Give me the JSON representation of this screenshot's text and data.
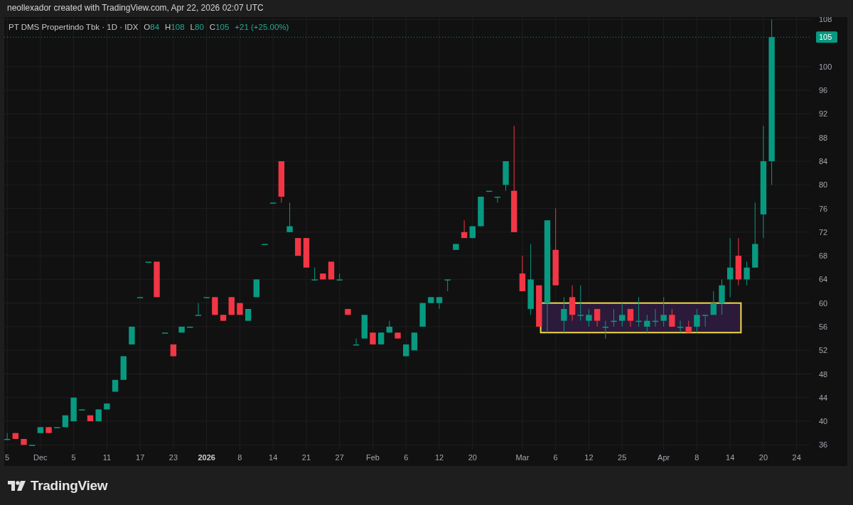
{
  "caption": "neollexador created with TradingView.com, Apr 22, 2026 02:07 UTC",
  "legend": {
    "symbol": "PT DMS Propertindo Tbk · 1D · IDX",
    "values": [
      {
        "label": "O",
        "value": "84"
      },
      {
        "label": "H",
        "value": "108"
      },
      {
        "label": "L",
        "value": "80"
      },
      {
        "label": "C",
        "value": "105"
      }
    ],
    "change": "+21 (+25.00%)"
  },
  "chart_data": {
    "type": "candlestick",
    "grid": true,
    "ylim": [
      35.2,
      108.4
    ],
    "yticks": [
      36,
      40,
      44,
      48,
      52,
      56,
      60,
      64,
      68,
      72,
      76,
      80,
      84,
      88,
      92,
      96,
      100,
      108
    ],
    "categories": [
      "5",
      null,
      null,
      null,
      "Dec",
      null,
      null,
      null,
      "5",
      null,
      null,
      null,
      "11",
      null,
      null,
      null,
      "17",
      null,
      null,
      null,
      "23",
      null,
      null,
      null,
      "2026",
      null,
      null,
      null,
      "8",
      null,
      null,
      null,
      "14",
      null,
      null,
      null,
      "21",
      null,
      null,
      null,
      "27",
      null,
      null,
      null,
      "Feb",
      null,
      null,
      null,
      "6",
      null,
      null,
      null,
      "12",
      null,
      null,
      null,
      "20",
      null,
      null,
      null,
      null,
      null,
      "Mar",
      null,
      null,
      null,
      "6",
      null,
      null,
      null,
      "12",
      null,
      null,
      null,
      "25",
      null,
      null,
      null,
      null,
      "Apr",
      null,
      null,
      null,
      "8",
      null,
      null,
      null,
      "14",
      null,
      null,
      null,
      "20",
      null,
      null,
      null,
      "24",
      null
    ],
    "ohlc": [
      [
        37,
        38,
        37,
        37
      ],
      [
        38,
        38,
        37,
        37
      ],
      [
        37,
        37,
        36,
        36
      ],
      [
        36,
        36,
        36,
        36
      ],
      [
        38,
        39,
        38,
        39
      ],
      [
        39,
        39,
        38,
        38
      ],
      [
        39,
        39,
        39,
        39
      ],
      [
        39,
        41,
        39,
        41
      ],
      [
        40,
        44,
        40,
        44
      ],
      [
        42,
        42,
        42,
        42
      ],
      [
        41,
        41,
        40,
        40
      ],
      [
        40,
        42,
        40,
        42
      ],
      [
        42,
        43,
        42,
        43
      ],
      [
        45,
        47,
        45,
        47
      ],
      [
        47,
        51,
        47,
        51
      ],
      [
        53,
        56,
        53,
        56
      ],
      [
        61,
        61,
        61,
        61
      ],
      [
        67,
        67,
        67,
        67
      ],
      [
        67,
        67,
        61,
        61
      ],
      [
        55,
        55,
        55,
        55
      ],
      [
        53,
        53,
        51,
        51
      ],
      [
        55,
        56,
        55,
        56
      ],
      [
        56,
        56,
        56,
        56
      ],
      [
        58,
        60,
        58,
        58
      ],
      [
        61,
        61,
        61,
        61
      ],
      [
        61,
        61,
        58,
        58
      ],
      [
        58,
        58,
        57,
        57
      ],
      [
        61,
        61,
        58,
        58
      ],
      [
        60,
        60,
        58,
        58
      ],
      [
        57,
        59,
        57,
        59
      ],
      [
        61,
        64,
        61,
        64
      ],
      [
        70,
        70,
        70,
        70
      ],
      [
        77,
        77,
        77,
        77
      ],
      [
        84,
        84,
        77,
        78
      ],
      [
        72,
        77,
        72,
        73
      ],
      [
        71,
        71,
        68,
        68
      ],
      [
        71,
        71,
        66,
        66
      ],
      [
        64,
        66,
        64,
        64
      ],
      [
        65,
        65,
        64,
        64
      ],
      [
        67,
        67,
        64,
        64
      ],
      [
        64,
        65,
        64,
        64
      ],
      [
        59,
        59,
        58,
        58
      ],
      [
        53,
        54,
        53,
        53
      ],
      [
        54,
        58,
        54,
        58
      ],
      [
        55,
        55,
        53,
        53
      ],
      [
        53,
        55,
        53,
        55
      ],
      [
        55,
        57,
        55,
        56
      ],
      [
        55,
        55,
        54,
        54
      ],
      [
        51,
        53,
        51,
        53
      ],
      [
        52,
        55,
        52,
        55
      ],
      [
        56,
        60,
        56,
        60
      ],
      [
        60,
        61,
        60,
        61
      ],
      [
        60,
        61,
        59,
        61
      ],
      [
        64,
        64,
        62,
        64
      ],
      [
        69,
        70,
        69,
        70
      ],
      [
        72,
        74,
        71,
        71
      ],
      [
        71,
        73,
        71,
        73
      ],
      [
        73,
        78,
        73,
        78
      ],
      [
        79,
        79,
        79,
        79
      ],
      [
        78,
        78,
        77,
        78
      ],
      [
        80,
        84,
        79,
        84
      ],
      [
        79,
        90,
        72,
        72
      ],
      [
        65,
        68,
        62,
        62
      ],
      [
        59,
        70,
        58,
        64
      ],
      [
        63,
        63,
        56,
        56
      ],
      [
        60,
        74,
        55,
        74
      ],
      [
        69,
        76,
        63,
        63
      ],
      [
        57,
        61,
        55,
        59
      ],
      [
        61,
        63,
        57,
        58
      ],
      [
        58,
        63,
        57,
        58
      ],
      [
        57,
        59,
        56,
        58
      ],
      [
        59,
        59,
        56,
        57
      ],
      [
        56,
        57,
        54,
        56
      ],
      [
        57,
        59,
        56,
        57
      ],
      [
        57,
        60,
        56,
        58
      ],
      [
        59,
        59,
        56,
        57
      ],
      [
        57,
        61,
        56,
        57
      ],
      [
        56,
        58,
        55,
        57
      ],
      [
        57,
        59,
        56,
        57
      ],
      [
        57,
        61,
        56,
        58
      ],
      [
        58,
        59,
        56,
        56
      ],
      [
        56,
        57,
        55,
        56
      ],
      [
        56,
        57,
        55,
        55
      ],
      [
        56,
        59,
        55,
        58
      ],
      [
        58,
        58,
        56,
        58
      ],
      [
        58,
        62,
        58,
        60
      ],
      [
        60,
        64,
        58,
        63
      ],
      [
        64,
        71,
        61,
        66
      ],
      [
        68,
        71,
        63,
        64
      ],
      [
        64,
        67,
        63,
        66
      ],
      [
        66,
        77,
        66,
        70
      ],
      [
        75,
        90,
        71,
        84
      ],
      [
        84,
        108,
        80,
        105
      ],
      null,
      null,
      null,
      null
    ],
    "ref_lines": [
      {
        "axis": "y",
        "value": 105,
        "label": "105"
      }
    ],
    "bands": [
      {
        "axis": "y",
        "from": 55,
        "to": 60
      }
    ]
  },
  "footer": {
    "brand": "TradingView"
  }
}
